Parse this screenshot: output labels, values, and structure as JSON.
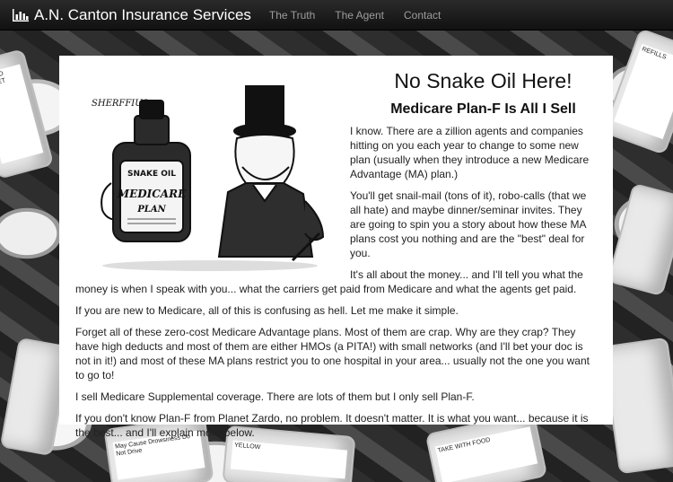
{
  "navbar": {
    "brand": "A.N. Canton Insurance Services",
    "brand_icon": "bar-chart-icon",
    "links": [
      "The Truth",
      "The Agent",
      "Contact"
    ]
  },
  "content": {
    "title": "No Snake Oil Here!",
    "subtitle": "Medicare Plan-F Is All I Sell",
    "cartoon": {
      "signature": "SHERFFIUS",
      "bottle_label_top": "SNAKE OIL",
      "bottle_label_main": "MEDICARE",
      "bottle_label_sub": "PLAN"
    },
    "paragraphs": [
      "I know. There are a zillion agents and companies hitting on you each year to change to some new plan (usually when they introduce a new Medicare Advantage (MA) plan.)",
      "You'll get snail-mail (tons of it), robo-calls (that we all hate) and maybe dinner/seminar invites. They are going to spin you a story about how these MA plans cost you nothing and are the \"best\" deal for you.",
      "It's all about the money... and I'll tell you what the money is when I speak with you... what the carriers get paid from Medicare and what the agents get paid.",
      "If you are new to Medicare, all of this is confusing as hell. Let me make it simple.",
      "Forget all of these zero-cost Medicare Advantage plans. Most of them are crap. Why are they crap? They have high deducts and most of them are either HMOs (a PITA!) with small networks (and I'll bet your doc is not in it!) and most of these MA plans restrict you to one hospital in your area... usually not the one you want to go to!",
      "I sell Medicare Supplemental coverage. There are lots of them but I only sell Plan-F.",
      "If you don't know Plan-F from Planet Zardo, no problem. It doesn't matter. It is what you want... because it is the best... and I'll explain more below."
    ]
  },
  "background": {
    "bottle_labels": [
      "May Cause Drowsiness Do Not Drive",
      "TAKE WITH FOOD",
      "YELLOW",
      "ROUND TABLET",
      "REFILLS"
    ]
  }
}
